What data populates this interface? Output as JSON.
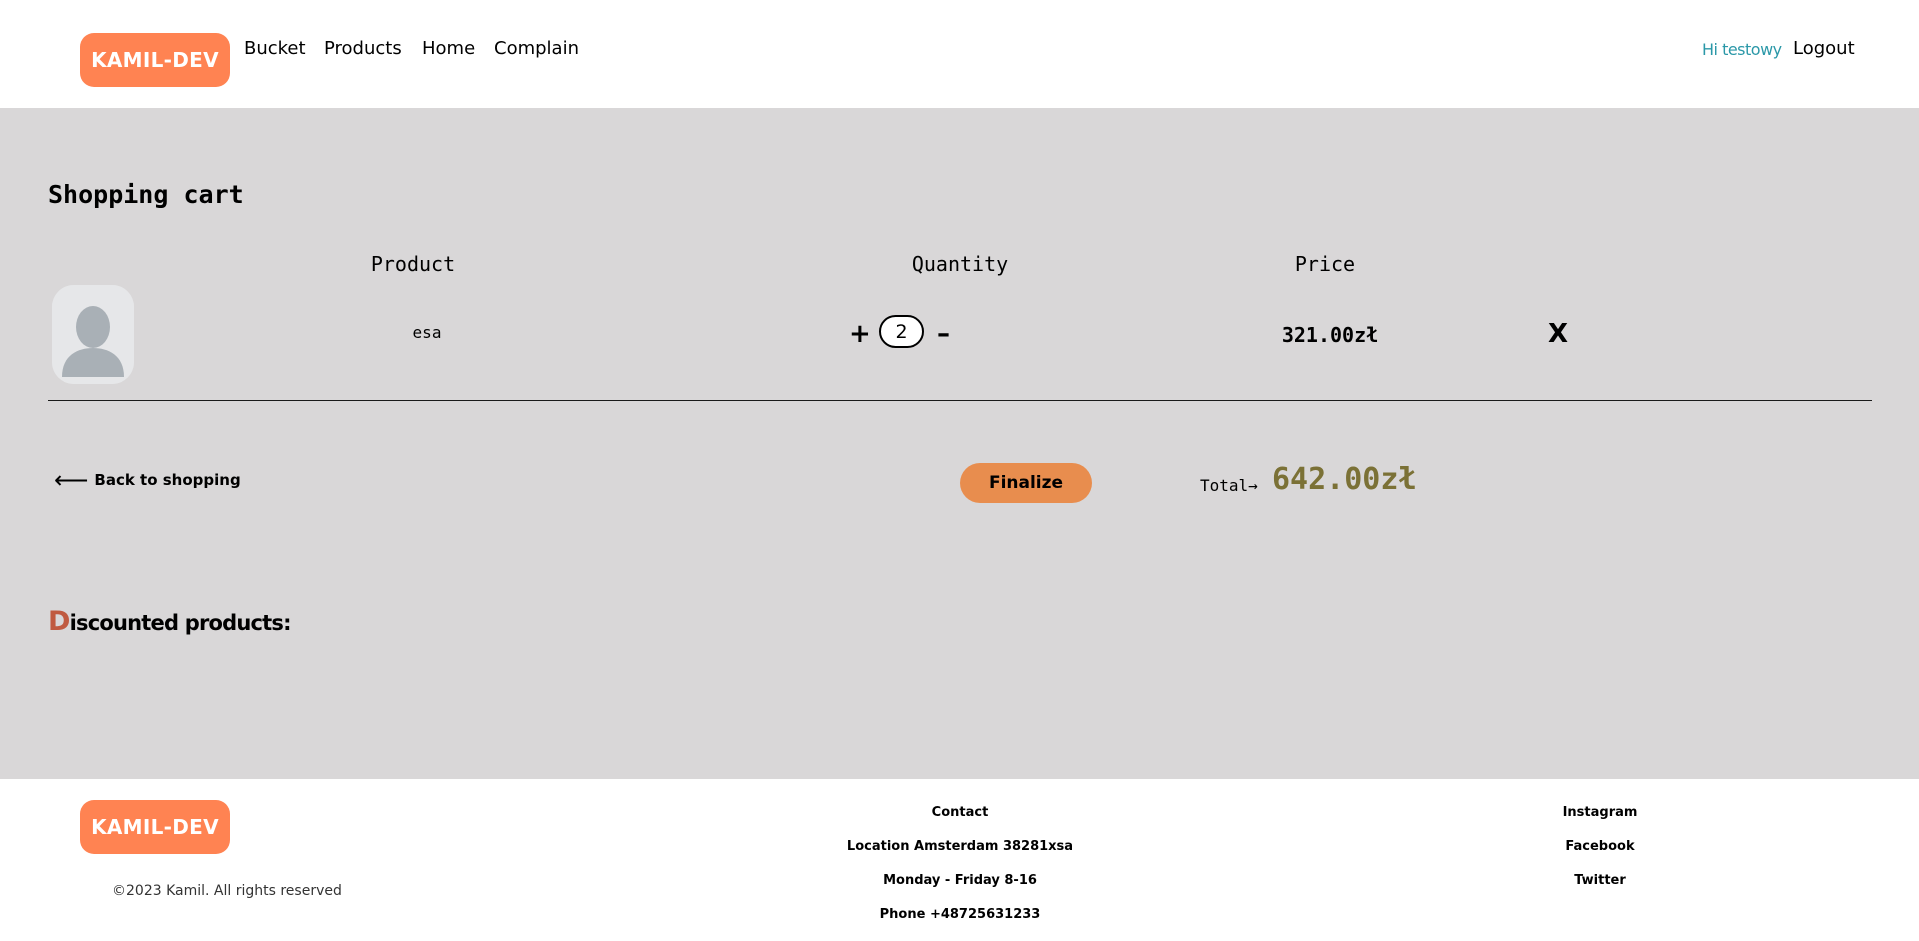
{
  "header": {
    "logo": "KAMIL-DEV",
    "nav": [
      "Bucket",
      "Products",
      "Home",
      "Complain"
    ],
    "greeting": "Hi testowy",
    "logout": "Logout"
  },
  "cart": {
    "title": "Shopping cart",
    "columns": {
      "product": "Product",
      "quantity": "Quantity",
      "price": "Price"
    },
    "items": [
      {
        "name": "esa",
        "quantity": "2",
        "price": "321.00zł",
        "plus": "+",
        "minus": "–",
        "remove": "X"
      }
    ],
    "back_arrow": "⟵",
    "back_label": "Back to shopping",
    "finalize_label": "Finalize",
    "total_label": "Total→",
    "total_value": "642.00zł"
  },
  "discount": {
    "first_letter": "D",
    "rest": "iscounted products:"
  },
  "footer": {
    "logo": "KAMIL-DEV",
    "copyright": "©2023 Kamil. All rights reserved",
    "contact": [
      "Contact",
      "Location Amsterdam 38281xsa",
      "Monday - Friday 8-16",
      "Phone +48725631233"
    ],
    "social": [
      "Instagram",
      "Facebook",
      "Twitter"
    ]
  },
  "colors": {
    "brand": "#ff8352",
    "finalize": "#e88d4e",
    "greeting": "#2b98a8",
    "total": "#7b7136",
    "discount_accent": "#c05a40",
    "main_bg": "#d9d7d8"
  }
}
